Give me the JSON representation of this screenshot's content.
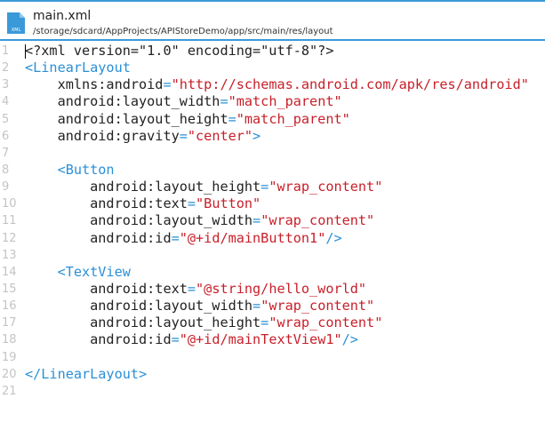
{
  "header": {
    "title": "main.xml",
    "path": "/storage/sdcard/AppProjects/APIStoreDemo/app/src/main/res/layout",
    "icon": "xml-file-icon",
    "icon_label": "XML"
  },
  "colors": {
    "accent": "#3a9ad9",
    "tag": "#2b8fd6",
    "string": "#c8202a",
    "text": "#222222",
    "line_number": "#c4c4c4"
  },
  "lines": [
    {
      "n": "1",
      "tokens": [
        [
          "a",
          "<?xml version=\"1.0\" encoding=\"utf-8\"?>"
        ]
      ]
    },
    {
      "n": "2",
      "tokens": [
        [
          "t",
          "<LinearLayout"
        ]
      ]
    },
    {
      "n": "3",
      "tokens": [
        [
          "a",
          "    xmlns:android"
        ],
        [
          "e",
          "="
        ],
        [
          "s",
          "\"http://schemas.android.com/apk/res/android\""
        ]
      ]
    },
    {
      "n": "4",
      "tokens": [
        [
          "a",
          "    android:layout_width"
        ],
        [
          "e",
          "="
        ],
        [
          "s",
          "\"match_parent\""
        ]
      ]
    },
    {
      "n": "5",
      "tokens": [
        [
          "a",
          "    android:layout_height"
        ],
        [
          "e",
          "="
        ],
        [
          "s",
          "\"match_parent\""
        ]
      ]
    },
    {
      "n": "6",
      "tokens": [
        [
          "a",
          "    android:gravity"
        ],
        [
          "e",
          "="
        ],
        [
          "s",
          "\"center\""
        ],
        [
          "t",
          ">"
        ]
      ]
    },
    {
      "n": "7",
      "tokens": []
    },
    {
      "n": "8",
      "tokens": [
        [
          "t",
          "    <Button"
        ]
      ]
    },
    {
      "n": "9",
      "tokens": [
        [
          "a",
          "        android:layout_height"
        ],
        [
          "e",
          "="
        ],
        [
          "s",
          "\"wrap_content\""
        ]
      ]
    },
    {
      "n": "10",
      "tokens": [
        [
          "a",
          "        android:text"
        ],
        [
          "e",
          "="
        ],
        [
          "s",
          "\"Button\""
        ]
      ]
    },
    {
      "n": "11",
      "tokens": [
        [
          "a",
          "        android:layout_width"
        ],
        [
          "e",
          "="
        ],
        [
          "s",
          "\"wrap_content\""
        ]
      ]
    },
    {
      "n": "12",
      "tokens": [
        [
          "a",
          "        android:id"
        ],
        [
          "e",
          "="
        ],
        [
          "s",
          "\"@+id/mainButton1\""
        ],
        [
          "t",
          "/>"
        ]
      ]
    },
    {
      "n": "13",
      "tokens": []
    },
    {
      "n": "14",
      "tokens": [
        [
          "t",
          "    <TextView"
        ]
      ]
    },
    {
      "n": "15",
      "tokens": [
        [
          "a",
          "        android:text"
        ],
        [
          "e",
          "="
        ],
        [
          "s",
          "\"@string/hello_world\""
        ]
      ]
    },
    {
      "n": "16",
      "tokens": [
        [
          "a",
          "        android:layout_width"
        ],
        [
          "e",
          "="
        ],
        [
          "s",
          "\"wrap_content\""
        ]
      ]
    },
    {
      "n": "17",
      "tokens": [
        [
          "a",
          "        android:layout_height"
        ],
        [
          "e",
          "="
        ],
        [
          "s",
          "\"wrap_content\""
        ]
      ]
    },
    {
      "n": "18",
      "tokens": [
        [
          "a",
          "        android:id"
        ],
        [
          "e",
          "="
        ],
        [
          "s",
          "\"@+id/mainTextView1\""
        ],
        [
          "t",
          "/>"
        ]
      ]
    },
    {
      "n": "19",
      "tokens": []
    },
    {
      "n": "20",
      "tokens": [
        [
          "t",
          "</LinearLayout>"
        ]
      ]
    },
    {
      "n": "21",
      "tokens": []
    }
  ]
}
